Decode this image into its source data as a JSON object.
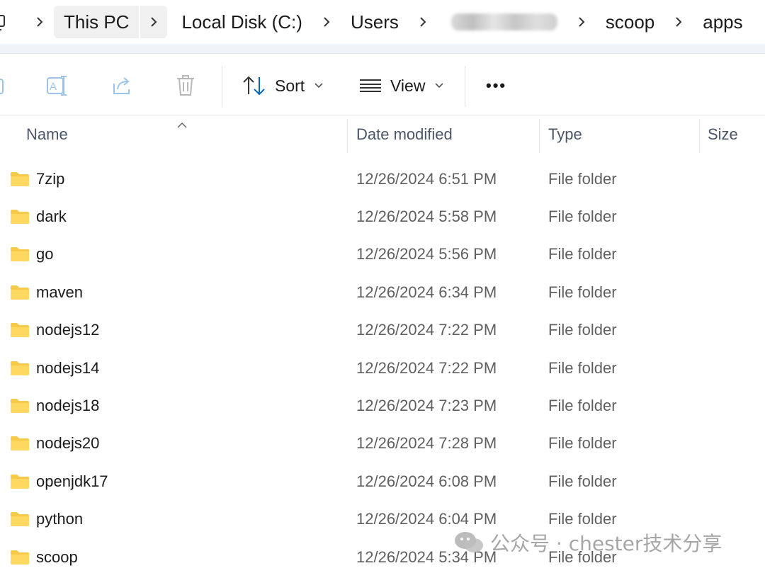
{
  "breadcrumb": {
    "items": [
      "This PC",
      "Local Disk (C:)",
      "Users",
      "",
      "scoop",
      "apps"
    ]
  },
  "toolbar": {
    "sort_label": "Sort",
    "view_label": "View",
    "more_label": "•••"
  },
  "columns": {
    "name": "Name",
    "date": "Date modified",
    "type": "Type",
    "size": "Size"
  },
  "files": [
    {
      "name": "7zip",
      "date": "12/26/2024 6:51 PM",
      "type": "File folder"
    },
    {
      "name": "dark",
      "date": "12/26/2024 5:58 PM",
      "type": "File folder"
    },
    {
      "name": "go",
      "date": "12/26/2024 5:56 PM",
      "type": "File folder"
    },
    {
      "name": "maven",
      "date": "12/26/2024 6:34 PM",
      "type": "File folder"
    },
    {
      "name": "nodejs12",
      "date": "12/26/2024 7:22 PM",
      "type": "File folder"
    },
    {
      "name": "nodejs14",
      "date": "12/26/2024 7:22 PM",
      "type": "File folder"
    },
    {
      "name": "nodejs18",
      "date": "12/26/2024 7:23 PM",
      "type": "File folder"
    },
    {
      "name": "nodejs20",
      "date": "12/26/2024 7:28 PM",
      "type": "File folder"
    },
    {
      "name": "openjdk17",
      "date": "12/26/2024 6:08 PM",
      "type": "File folder"
    },
    {
      "name": "python",
      "date": "12/26/2024 6:04 PM",
      "type": "File folder"
    },
    {
      "name": "scoop",
      "date": "12/26/2024 5:34 PM",
      "type": "File folder"
    }
  ],
  "watermark": {
    "text": "公众号 · chester技术分享"
  },
  "colors": {
    "folder": "#f7c948",
    "accent": "#0067c0",
    "icon_disabled": "#9ec3e6"
  }
}
